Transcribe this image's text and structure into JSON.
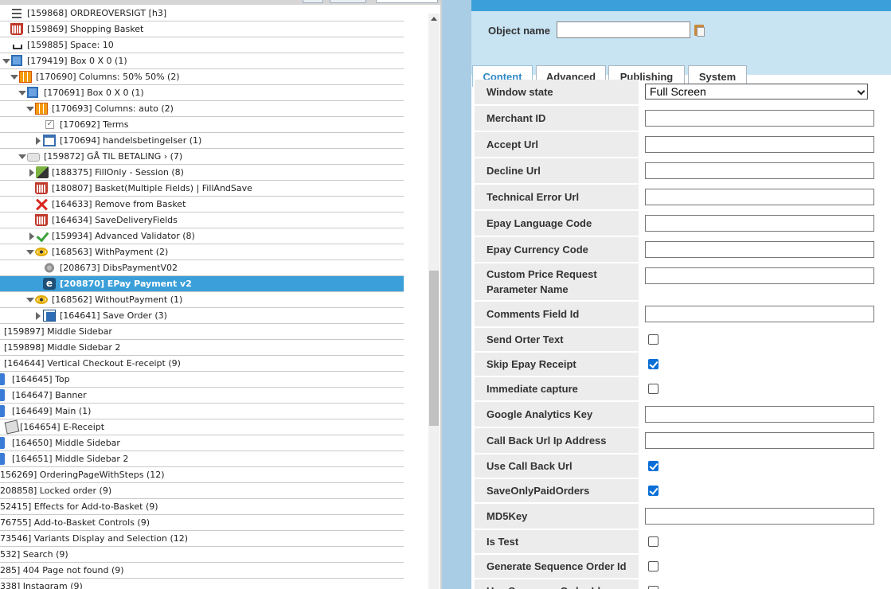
{
  "tree": {
    "rows": [
      {
        "label": "[159868] ORDREOVERSIGT [h3]",
        "icon": "lines-icon"
      },
      {
        "label": "[159869] Shopping Basket",
        "icon": "basket-icon"
      },
      {
        "label": "[159885] Space: 10",
        "icon": "space-icon"
      },
      {
        "label": "[179419] Box 0 X 0 (1)",
        "icon": "box-icon",
        "expander": "down"
      },
      {
        "label": "[170690] Columns: 50% 50% (2)",
        "icon": "columns-icon",
        "expander": "down"
      },
      {
        "label": "[170691] Box 0 X 0 (1)",
        "icon": "box-icon",
        "expander": "down"
      },
      {
        "label": "[170693] Columns: auto (2)",
        "icon": "columns-icon",
        "expander": "down"
      },
      {
        "label": "[170692] Terms",
        "icon": "checkbox-icon"
      },
      {
        "label": "[170694] handelsbetingelser (1)",
        "icon": "window-icon",
        "expander": "right"
      },
      {
        "label": "[159872] GÅ TIL BETALING    › (7)",
        "icon": "folder-icon",
        "expander": "down"
      },
      {
        "label": "[188375] FillOnly - Session (8)",
        "icon": "fill-icon",
        "expander": "right"
      },
      {
        "label": "[180807] Basket(Multiple Fields) | FillAndSave",
        "icon": "basket-icon"
      },
      {
        "label": "[164633] Remove from Basket",
        "icon": "cross-icon"
      },
      {
        "label": "[164634] SaveDeliveryFields",
        "icon": "basket-icon"
      },
      {
        "label": "[159934] Advanced Validator (8)",
        "icon": "checkmark-icon",
        "expander": "right"
      },
      {
        "label": "[168563] WithPayment (2)",
        "icon": "eye-icon",
        "expander": "down"
      },
      {
        "label": "[208673] DibsPaymentV02",
        "icon": "gear-icon"
      },
      {
        "label": "[208870] EPay Payment v2",
        "icon": "epay-icon",
        "selected": true
      },
      {
        "label": "[168562] WithoutPayment (1)",
        "icon": "eye-icon",
        "expander": "down"
      },
      {
        "label": "[164641] Save Order (3)",
        "icon": "save-icon",
        "expander": "right"
      },
      {
        "label": "[159897] Middle Sidebar"
      },
      {
        "label": "[159898] Middle Sidebar 2"
      },
      {
        "label": "[164644] Vertical Checkout E-receipt (9)"
      },
      {
        "label": "[164645] Top",
        "icon": "puzzle-icon"
      },
      {
        "label": "[164647] Banner",
        "icon": "puzzle-icon"
      },
      {
        "label": "[164649] Main (1)",
        "icon": "puzzle-icon"
      },
      {
        "label": "[164654] E-Receipt",
        "icon": "receipt-icon"
      },
      {
        "label": "[164650] Middle Sidebar",
        "icon": "puzzle-icon"
      },
      {
        "label": "[164651] Middle Sidebar 2",
        "icon": "puzzle-icon"
      },
      {
        "label": "156269] OrderingPageWithSteps (12)"
      },
      {
        "label": "208858] Locked order (9)"
      },
      {
        "label": "52415] Effects for Add-to-Basket (9)"
      },
      {
        "label": "76755] Add-to-Basket Controls (9)"
      },
      {
        "label": "73546] Variants Display and Selection (12)"
      },
      {
        "label": "532] Search (9)"
      },
      {
        "label": "285] 404 Page not found (9)"
      },
      {
        "label": "338] Instagram (9)"
      }
    ]
  },
  "editor": {
    "object_name_label": "Object name",
    "object_name_value": "",
    "tabs": [
      {
        "label": "Content",
        "active": true
      },
      {
        "label": "Advanced"
      },
      {
        "label": "Publishing"
      },
      {
        "label": "System"
      }
    ],
    "fields": [
      {
        "label": "Window state",
        "type": "select",
        "value": "Full Screen"
      },
      {
        "label": "Merchant ID",
        "type": "text",
        "value": ""
      },
      {
        "label": "Accept Url",
        "type": "text",
        "value": ""
      },
      {
        "label": "Decline Url",
        "type": "text",
        "value": ""
      },
      {
        "label": "Technical Error Url",
        "type": "text",
        "value": ""
      },
      {
        "label": "Epay Language Code",
        "type": "text",
        "value": ""
      },
      {
        "label": "Epay Currency Code",
        "type": "text",
        "value": ""
      },
      {
        "label": "Custom Price Request Parameter Name",
        "type": "text",
        "value": ""
      },
      {
        "label": "Comments Field Id",
        "type": "text",
        "value": ""
      },
      {
        "label": "Send Orter Text",
        "type": "checkbox",
        "checked": false
      },
      {
        "label": "Skip Epay Receipt",
        "type": "checkbox",
        "checked": true
      },
      {
        "label": "Immediate capture",
        "type": "checkbox",
        "checked": false
      },
      {
        "label": "Google Analytics Key",
        "type": "text",
        "value": ""
      },
      {
        "label": "Call Back Url Ip Address",
        "type": "text",
        "value": ""
      },
      {
        "label": "Use Call Back Url",
        "type": "checkbox",
        "checked": true
      },
      {
        "label": "SaveOnlyPaidOrders",
        "type": "checkbox",
        "checked": true
      },
      {
        "label": "MD5Key",
        "type": "text",
        "value": ""
      },
      {
        "label": "Is Test",
        "type": "checkbox",
        "checked": false
      },
      {
        "label": "Generate Sequence Order Id",
        "type": "checkbox",
        "checked": false
      },
      {
        "label": "Use Sequence Order Id",
        "type": "checkbox",
        "checked": false
      }
    ]
  },
  "colors": {
    "accent": "#3b9fd9",
    "header_band": "#c8e3f2",
    "field_label_bg": "#ececec"
  }
}
